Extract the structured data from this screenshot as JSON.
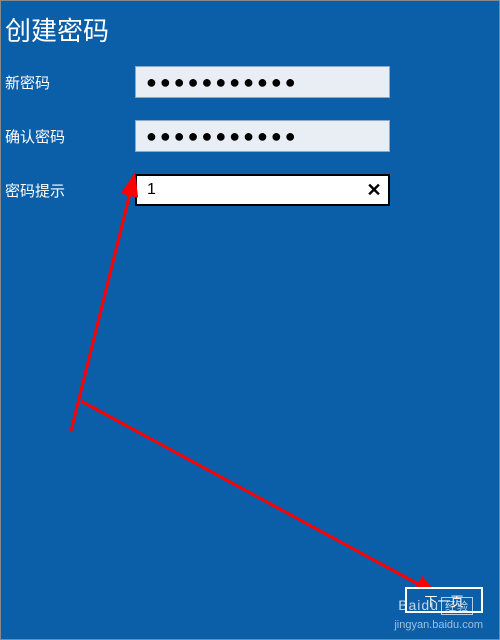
{
  "heading": "创建密码",
  "labels": {
    "new_password": "新密码",
    "confirm_password": "确认密码",
    "password_hint": "密码提示"
  },
  "fields": {
    "new_password_value": "●●●●●●●●●●●",
    "confirm_password_value": "●●●●●●●●●●●",
    "hint_value": "1"
  },
  "buttons": {
    "clear": "✕",
    "next": "下一页"
  },
  "watermark": {
    "brand": "Baidu",
    "tag": "经验",
    "url": "jingyan.baidu.com"
  }
}
